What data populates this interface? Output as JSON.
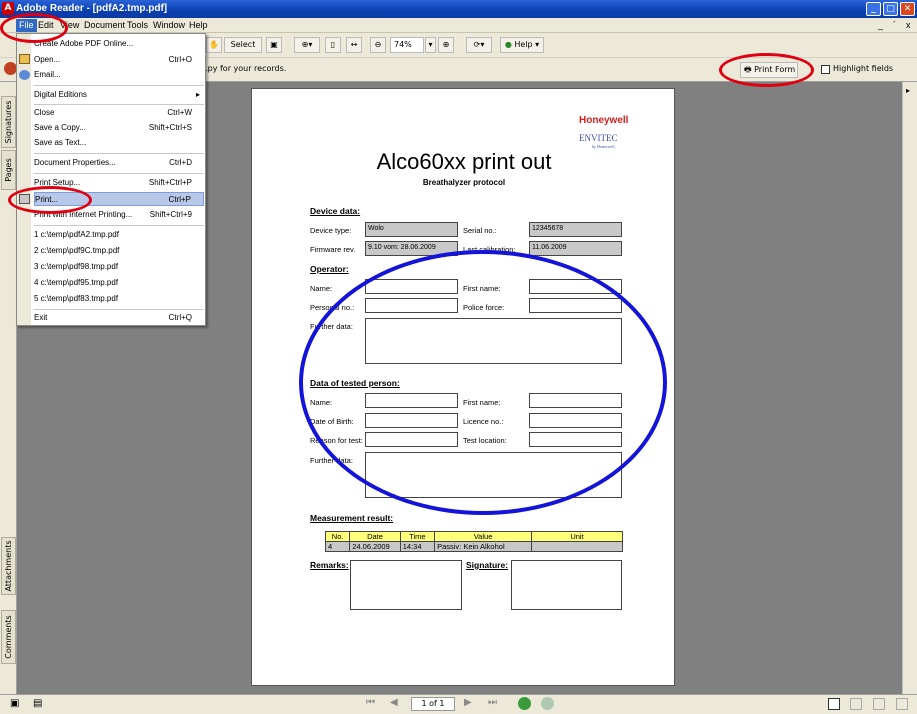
{
  "window": {
    "title": "Adobe Reader - [pdfA2.tmp.pdf]",
    "app_icon": "adobe-icon"
  },
  "menubar": {
    "items": [
      "File",
      "Edit",
      "View",
      "Document",
      "Tools",
      "Window",
      "Help"
    ]
  },
  "mdi": {
    "min": "_",
    "restore": "´",
    "close": "x"
  },
  "toolbar": {
    "select_label": "Select",
    "zoom_value": "74%",
    "help_label": "Help",
    "message": "...py for your records.",
    "print_form_label": "Print Form",
    "highlight_fields_label": "Highlight fields"
  },
  "left_tabs": [
    "Signatures",
    "Pages",
    "Attachments",
    "Comments"
  ],
  "status": {
    "page_indicator": "1 of 1"
  },
  "file_menu": {
    "items": [
      {
        "label": "Create Adobe PDF Online...",
        "shortcut": ""
      },
      {
        "label": "Open...",
        "shortcut": "Ctrl+O"
      },
      {
        "label": "Email...",
        "shortcut": ""
      },
      {
        "label": "Digital Editions",
        "shortcut": "▸"
      },
      {
        "label": "Close",
        "shortcut": "Ctrl+W"
      },
      {
        "label": "Save a Copy...",
        "shortcut": "Shift+Ctrl+S"
      },
      {
        "label": "Save as Text...",
        "shortcut": ""
      },
      {
        "label": "Document Properties...",
        "shortcut": "Ctrl+D"
      },
      {
        "label": "Print Setup...",
        "shortcut": "Shift+Ctrl+P"
      },
      {
        "label": "Print...",
        "shortcut": "Ctrl+P"
      },
      {
        "label": "Print with Internet Printing...",
        "shortcut": "Shift+Ctrl+9"
      },
      {
        "label": "1 c:\\temp\\pdfA2.tmp.pdf",
        "shortcut": ""
      },
      {
        "label": "2 c:\\temp\\pdf9C.tmp.pdf",
        "shortcut": ""
      },
      {
        "label": "3 c:\\temp\\pdf98.tmp.pdf",
        "shortcut": ""
      },
      {
        "label": "4 c:\\temp\\pdf95.tmp.pdf",
        "shortcut": ""
      },
      {
        "label": "5 c:\\temp\\pdf83.tmp.pdf",
        "shortcut": ""
      },
      {
        "label": "Exit",
        "shortcut": "Ctrl+Q"
      }
    ]
  },
  "document": {
    "brand": "Honeywell",
    "brand2": "ENVITEC",
    "brand2_sub": "by Honeywell",
    "title": "Alco60xx print out",
    "subtitle": "Breathalyzer protocol",
    "device_section": "Device data:",
    "device_type_label": "Device type:",
    "device_type_value": "Wolo",
    "serial_label": "Serial no.:",
    "serial_value": "12345678",
    "firmware_label": "Firmware rev.",
    "firmware_value": "9.10  vom: 28.06.2009",
    "calibration_label": "Last calibration:",
    "calibration_value": "11.06.2009",
    "operator_section": "Operator:",
    "op_name": "Name:",
    "op_first": "First name:",
    "op_personal": "Personal no.:",
    "op_police": "Police force:",
    "op_further": "Further data:",
    "tested_section": "Data of tested person:",
    "tp_name": "Name:",
    "tp_first": "First name:",
    "tp_dob": "Date of Birth:",
    "tp_licence": "Licence no.:",
    "tp_reason": "Reason for test:",
    "tp_location": "Test location:",
    "tp_further": "Further data:",
    "measurement_section": "Measurement result:",
    "table_headers": [
      "No.",
      "Date",
      "Time",
      "Value",
      "Unit"
    ],
    "table_row": [
      "4",
      "24.06.2009",
      "14:34",
      "Passiv: Kein Alkohol",
      ""
    ],
    "remarks": "Remarks:",
    "signature": "Signature:"
  },
  "annotation_colors": {
    "red": "#e00010",
    "blue": "#1414d8"
  }
}
